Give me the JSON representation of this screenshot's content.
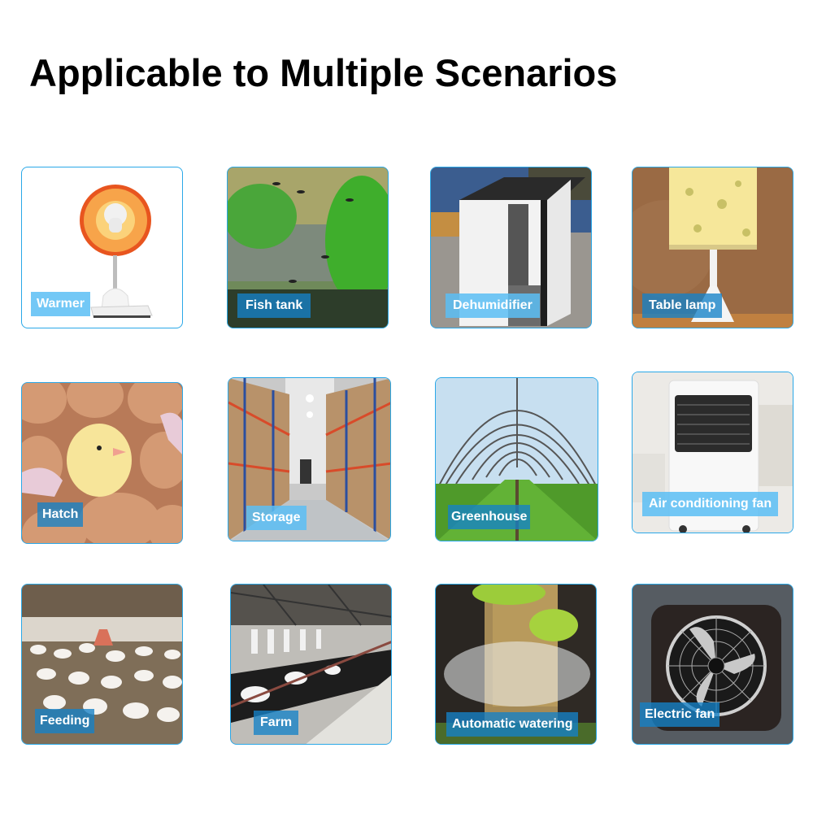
{
  "page": {
    "title": "Applicable to Multiple Scenarios"
  },
  "scenarios": [
    {
      "label": "Warmer",
      "icon": "space-heater-icon"
    },
    {
      "label": "Fish tank",
      "icon": "aquarium-icon"
    },
    {
      "label": "Dehumidifier",
      "icon": "dehumidifier-icon"
    },
    {
      "label": "Table lamp",
      "icon": "table-lamp-icon"
    },
    {
      "label": "Hatch",
      "icon": "hatching-chick-icon"
    },
    {
      "label": "Storage",
      "icon": "warehouse-icon"
    },
    {
      "label": "Greenhouse",
      "icon": "greenhouse-icon"
    },
    {
      "label": "Air conditioning fan",
      "icon": "air-cooler-icon"
    },
    {
      "label": "Feeding",
      "icon": "poultry-farm-icon"
    },
    {
      "label": "Farm",
      "icon": "cattle-farm-icon"
    },
    {
      "label": "Automatic watering",
      "icon": "sprinkler-icon"
    },
    {
      "label": "Electric fan",
      "icon": "exhaust-fan-icon"
    }
  ],
  "colors": {
    "card_border": "#2aa8e8",
    "label_light": "#5abef5",
    "label_dark": "#1482c8"
  }
}
